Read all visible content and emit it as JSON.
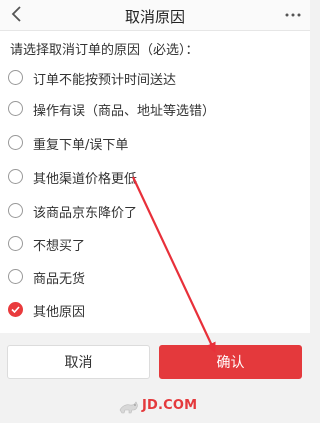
{
  "header": {
    "title": "取消原因",
    "back_icon": "chevron-left-icon",
    "more_icon": "more-dots-icon"
  },
  "form": {
    "prompt": "请选择取消订单的原因（必选）：",
    "selected_index": 7,
    "reasons": [
      {
        "label": "订单不能按预计时间送达",
        "checked": false
      },
      {
        "label": "操作有误（商品、地址等选错）",
        "checked": false
      },
      {
        "label": "重复下单/误下单",
        "checked": false
      },
      {
        "label": "其他渠道价格更低",
        "checked": false
      },
      {
        "label": "该商品京东降价了",
        "checked": false
      },
      {
        "label": "不想买了",
        "checked": false
      },
      {
        "label": "商品无货",
        "checked": false
      },
      {
        "label": "其他原因",
        "checked": true
      }
    ]
  },
  "footer": {
    "cancel_label": "取消",
    "confirm_label": "确认",
    "brand_text": "JD.COM"
  },
  "colors": {
    "accent": "#e4393c",
    "annotation_arrow": "#e8303a"
  }
}
